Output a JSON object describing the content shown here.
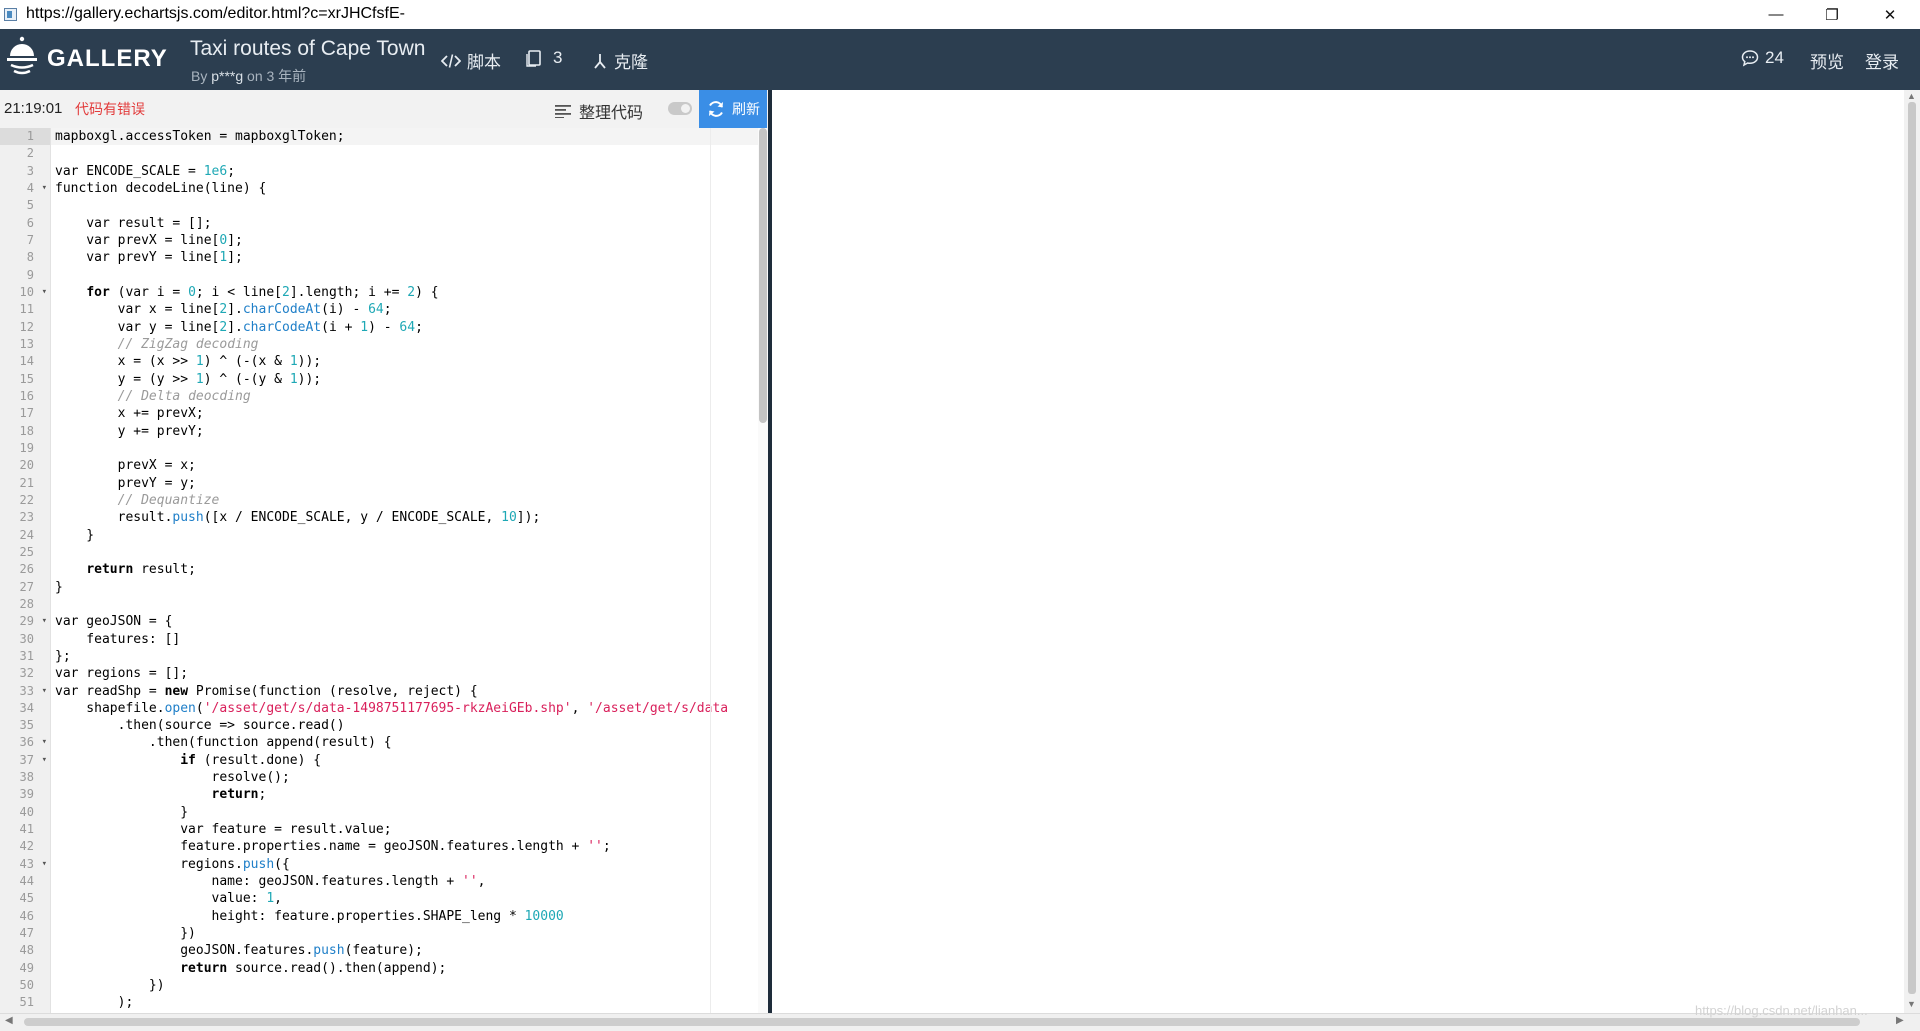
{
  "browser": {
    "url": "https://gallery.echartsjs.com/editor.html?c=xrJHCfsfE-",
    "minimize_glyph": "—",
    "restore_glyph": "❐",
    "close_glyph": "✕"
  },
  "nav": {
    "logo_text": "GALLERY",
    "chart_title": "Taxi routes of Cape Town",
    "by_prefix": "By",
    "author": "p***g",
    "date": "on 3 年前",
    "script_label": "脚本",
    "fork_count": "3",
    "clone_label": "克隆",
    "comment_count": "24",
    "preview_label": "预览",
    "login_label": "登录"
  },
  "editor": {
    "time": "21:19:01",
    "error_text": "代码有错误",
    "format_label": "整理代码",
    "refresh_label": "刷新",
    "line_numbers": [
      "1",
      "2",
      "3",
      "4",
      "5",
      "6",
      "7",
      "8",
      "9",
      "10",
      "11",
      "12",
      "13",
      "14",
      "15",
      "16",
      "17",
      "18",
      "19",
      "20",
      "21",
      "22",
      "23",
      "24",
      "25",
      "26",
      "27",
      "28",
      "29",
      "30",
      "31",
      "32",
      "33",
      "34",
      "35",
      "36",
      "37",
      "38",
      "39",
      "40",
      "41",
      "42",
      "43",
      "44",
      "45",
      "46",
      "47",
      "48",
      "49",
      "50",
      "51"
    ],
    "code_lines": [
      "mapboxgl.accessToken = mapboxglToken;",
      "",
      "var ENCODE_SCALE = 1e6;",
      "function decodeLine(line) {",
      "",
      "    var result = [];",
      "    var prevX = line[0];",
      "    var prevY = line[1];",
      "",
      "    for (var i = 0; i < line[2].length; i += 2) {",
      "        var x = line[2].charCodeAt(i) - 64;",
      "        var y = line[2].charCodeAt(i + 1) - 64;",
      "        // ZigZag decoding",
      "        x = (x >> 1) ^ (-(x & 1));",
      "        y = (y >> 1) ^ (-(y & 1));",
      "        // Delta deocding",
      "        x += prevX;",
      "        y += prevY;",
      "",
      "        prevX = x;",
      "        prevY = y;",
      "        // Dequantize",
      "        result.push([x / ENCODE_SCALE, y / ENCODE_SCALE, 10]);",
      "    }",
      "",
      "    return result;",
      "}",
      "",
      "var geoJSON = {",
      "    features: []",
      "};",
      "var regions = [];",
      "var readShp = new Promise(function (resolve, reject) {",
      "    shapefile.open('/asset/get/s/data-1498751177695-rkzAeiGEb.shp', '/asset/get/s/data",
      "        .then(source => source.read()",
      "            .then(function append(result) {",
      "                if (result.done) {",
      "                    resolve();",
      "                    return;",
      "                }",
      "                var feature = result.value;",
      "                feature.properties.name = geoJSON.features.length + '';",
      "                regions.push({",
      "                    name: geoJSON.features.length + '',",
      "                    value: 1,",
      "                    height: feature.properties.SHAPE_leng * 10000",
      "                })",
      "                geoJSON.features.push(feature);",
      "                return source.read().then(append);",
      "            })",
      "        );"
    ]
  },
  "watermark": "https://blog.csdn.net/lianhan..."
}
